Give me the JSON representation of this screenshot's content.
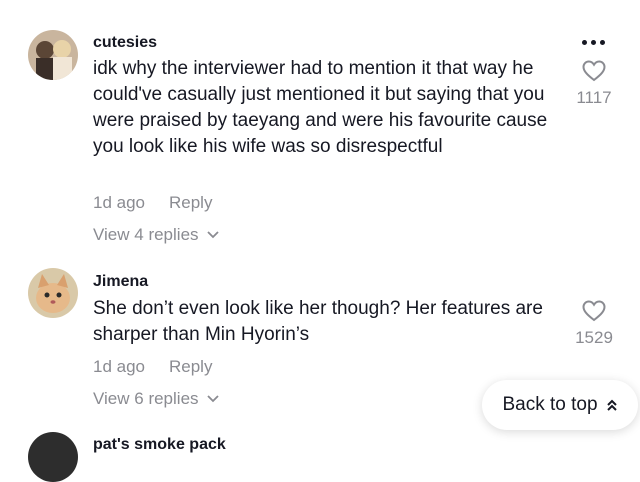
{
  "comments": [
    {
      "username": "cutesies",
      "text": "idk why the interviewer had to mention it that way he could've casually just mentioned it but saying that you were praised by taeyang and were his favourite cause you look like his wife was so disrespectful",
      "time": "1d ago",
      "reply_label": "Reply",
      "replies_label": "View 4 replies",
      "likes": "1117",
      "avatar_icon": "profile-photo"
    },
    {
      "username": "Jimena",
      "text": "She don’t even look like her though? Her features are sharper than Min Hyorin’s",
      "time": "1d ago",
      "reply_label": "Reply",
      "replies_label": "View 6 replies",
      "likes": "1529",
      "avatar_icon": "cat-photo"
    },
    {
      "username": "pat's smoke pack",
      "avatar_icon": "profile-photo"
    }
  ],
  "back_to_top_label": "Back to top",
  "more_icon": "ellipsis-icon",
  "colors": {
    "text": "#161823",
    "muted": "#8a8b91"
  }
}
